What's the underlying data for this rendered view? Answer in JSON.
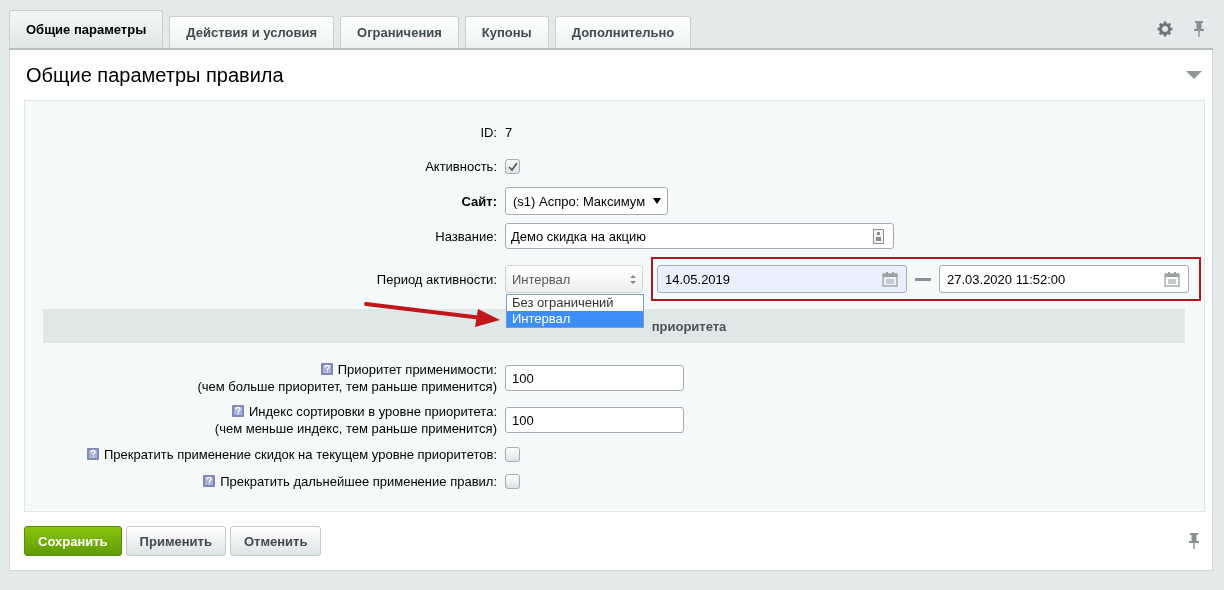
{
  "tabs": [
    {
      "label": "Общие параметры",
      "selected": true
    },
    {
      "label": "Действия и условия",
      "selected": false
    },
    {
      "label": "Ограничения",
      "selected": false
    },
    {
      "label": "Купоны",
      "selected": false
    },
    {
      "label": "Дополнительно",
      "selected": false
    }
  ],
  "panel": {
    "title": "Общие параметры правила",
    "expanded": true
  },
  "fields": [
    {
      "kind": "static",
      "label": "ID:",
      "required": false,
      "value": "7"
    },
    {
      "kind": "checkbox",
      "label": "Активность:",
      "required": false,
      "checked": true
    },
    {
      "kind": "select",
      "label": "Сайт:",
      "required": true,
      "value": "(s1) Аспро: Максимум"
    },
    {
      "kind": "text",
      "label": "Название:",
      "required": false,
      "value": "Демо скидка на акцию"
    },
    {
      "kind": "period",
      "label": "Период активности:",
      "required": false,
      "value": "Интервал",
      "options": [
        {
          "label": "Без ограничений",
          "selected": false
        },
        {
          "label": "Интервал",
          "selected": true
        }
      ],
      "from": "14.05.2019",
      "to": "27.03.2020 11:52:00"
    }
  ],
  "section_heading": "приоритета",
  "priority_fields": [
    {
      "kind": "number",
      "label": "Приоритет применимости:",
      "hint": "(чем больше приоритет, тем раньше применится)",
      "value": "100"
    },
    {
      "kind": "number",
      "label": "Индекс сортировки в уровне приоритета:",
      "hint": "(чем меньше индекс, тем раньше применится)",
      "value": "100"
    },
    {
      "kind": "checkbox",
      "label": "Прекратить применение скидок на текущем уровне приоритетов:",
      "checked": false
    },
    {
      "kind": "checkbox",
      "label": "Прекратить дальнейшее применение правил:",
      "checked": false
    }
  ],
  "buttons": [
    {
      "label": "Сохранить",
      "primary": true
    },
    {
      "label": "Применить",
      "primary": false
    },
    {
      "label": "Отменить",
      "primary": false
    }
  ]
}
